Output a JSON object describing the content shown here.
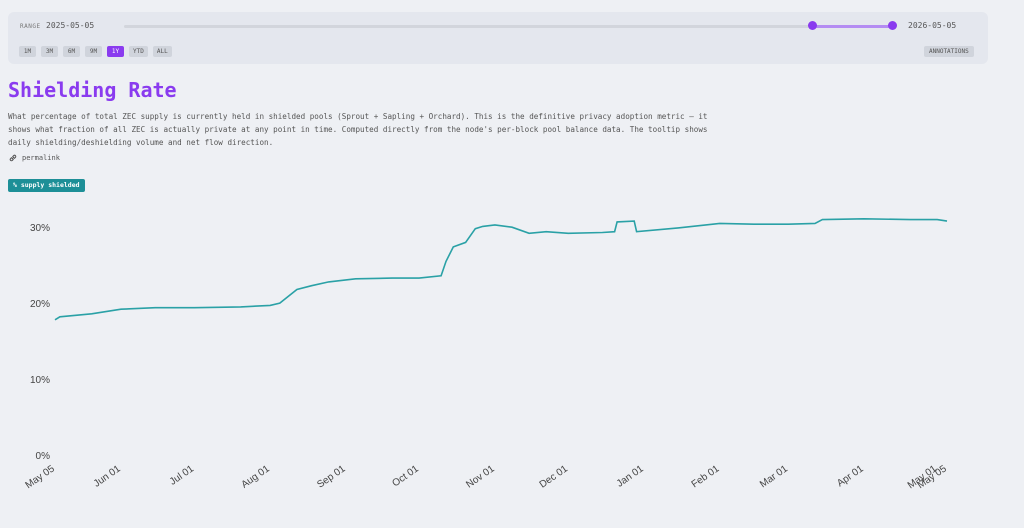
{
  "range": {
    "label": "RANGE",
    "start": "2025-05-05",
    "end": "2026-05-05",
    "selection": [
      0.895,
      1.0
    ],
    "presets": [
      "1M",
      "3M",
      "6M",
      "9M",
      "1Y",
      "YTD",
      "ALL"
    ],
    "active_preset": "1Y",
    "annotations_label": "ANNOTATIONS"
  },
  "page": {
    "title": "Shielding Rate",
    "description": "What percentage of total ZEC supply is currently held in shielded pools (Sprout + Sapling + Orchard). This is the definitive privacy adoption metric — it shows what fraction of all ZEC is actually private at any point in time. Computed directly from the node's per-block pool balance data. The tooltip shows daily shielding/deshielding volume and net flow direction.",
    "permalink": "permalink",
    "series_badge": "% supply shielded"
  },
  "colors": {
    "accent": "#8a3bef",
    "line": "#2aa1a6",
    "badge": "#1d8f97"
  },
  "chart_data": {
    "type": "line",
    "title": "",
    "xlabel": "",
    "ylabel": "",
    "ylim": [
      0,
      32
    ],
    "y_ticks": [
      0,
      10,
      20,
      30
    ],
    "y_tick_labels": [
      "0%",
      "10%",
      "20%",
      "30%"
    ],
    "x_range": [
      "2025-05-05",
      "2026-05-05"
    ],
    "x_ticks": [
      "2025-05-05",
      "2025-06-01",
      "2025-07-01",
      "2025-08-01",
      "2025-09-01",
      "2025-10-01",
      "2025-11-01",
      "2025-12-01",
      "2026-01-01",
      "2026-02-01",
      "2026-03-01",
      "2026-04-01",
      "2026-05-01",
      "2026-05-05"
    ],
    "x_tick_labels": [
      "May 05",
      "Jun 01",
      "Jul 01",
      "Aug 01",
      "Sep 01",
      "Oct 01",
      "Nov 01",
      "Dec 01",
      "Jan 01",
      "Feb 01",
      "Mar 01",
      "Apr 01",
      "May 01",
      "May 05"
    ],
    "grid": false,
    "series": [
      {
        "name": "% supply shielded",
        "x": [
          "2025-05-05",
          "2025-05-07",
          "2025-05-20",
          "2025-06-01",
          "2025-06-15",
          "2025-07-01",
          "2025-07-20",
          "2025-08-01",
          "2025-08-05",
          "2025-08-12",
          "2025-08-18",
          "2025-08-25",
          "2025-09-05",
          "2025-09-20",
          "2025-10-01",
          "2025-10-10",
          "2025-10-12",
          "2025-10-15",
          "2025-10-20",
          "2025-10-24",
          "2025-10-27",
          "2025-11-01",
          "2025-11-08",
          "2025-11-15",
          "2025-11-22",
          "2025-12-01",
          "2025-12-15",
          "2025-12-20",
          "2025-12-21",
          "2025-12-28",
          "2025-12-29",
          "2026-01-15",
          "2026-02-01",
          "2026-02-15",
          "2026-03-01",
          "2026-03-12",
          "2026-03-15",
          "2026-04-01",
          "2026-04-20",
          "2026-05-01",
          "2026-05-05"
        ],
        "values": [
          17.8,
          18.2,
          18.6,
          19.2,
          19.4,
          19.4,
          19.5,
          19.7,
          20.0,
          21.8,
          22.3,
          22.8,
          23.2,
          23.3,
          23.3,
          23.6,
          25.5,
          27.4,
          28.0,
          29.8,
          30.1,
          30.3,
          30.0,
          29.2,
          29.4,
          29.2,
          29.3,
          29.4,
          30.7,
          30.8,
          29.4,
          29.9,
          30.5,
          30.4,
          30.4,
          30.5,
          31.0,
          31.1,
          31.0,
          31.0,
          30.8
        ]
      }
    ]
  }
}
